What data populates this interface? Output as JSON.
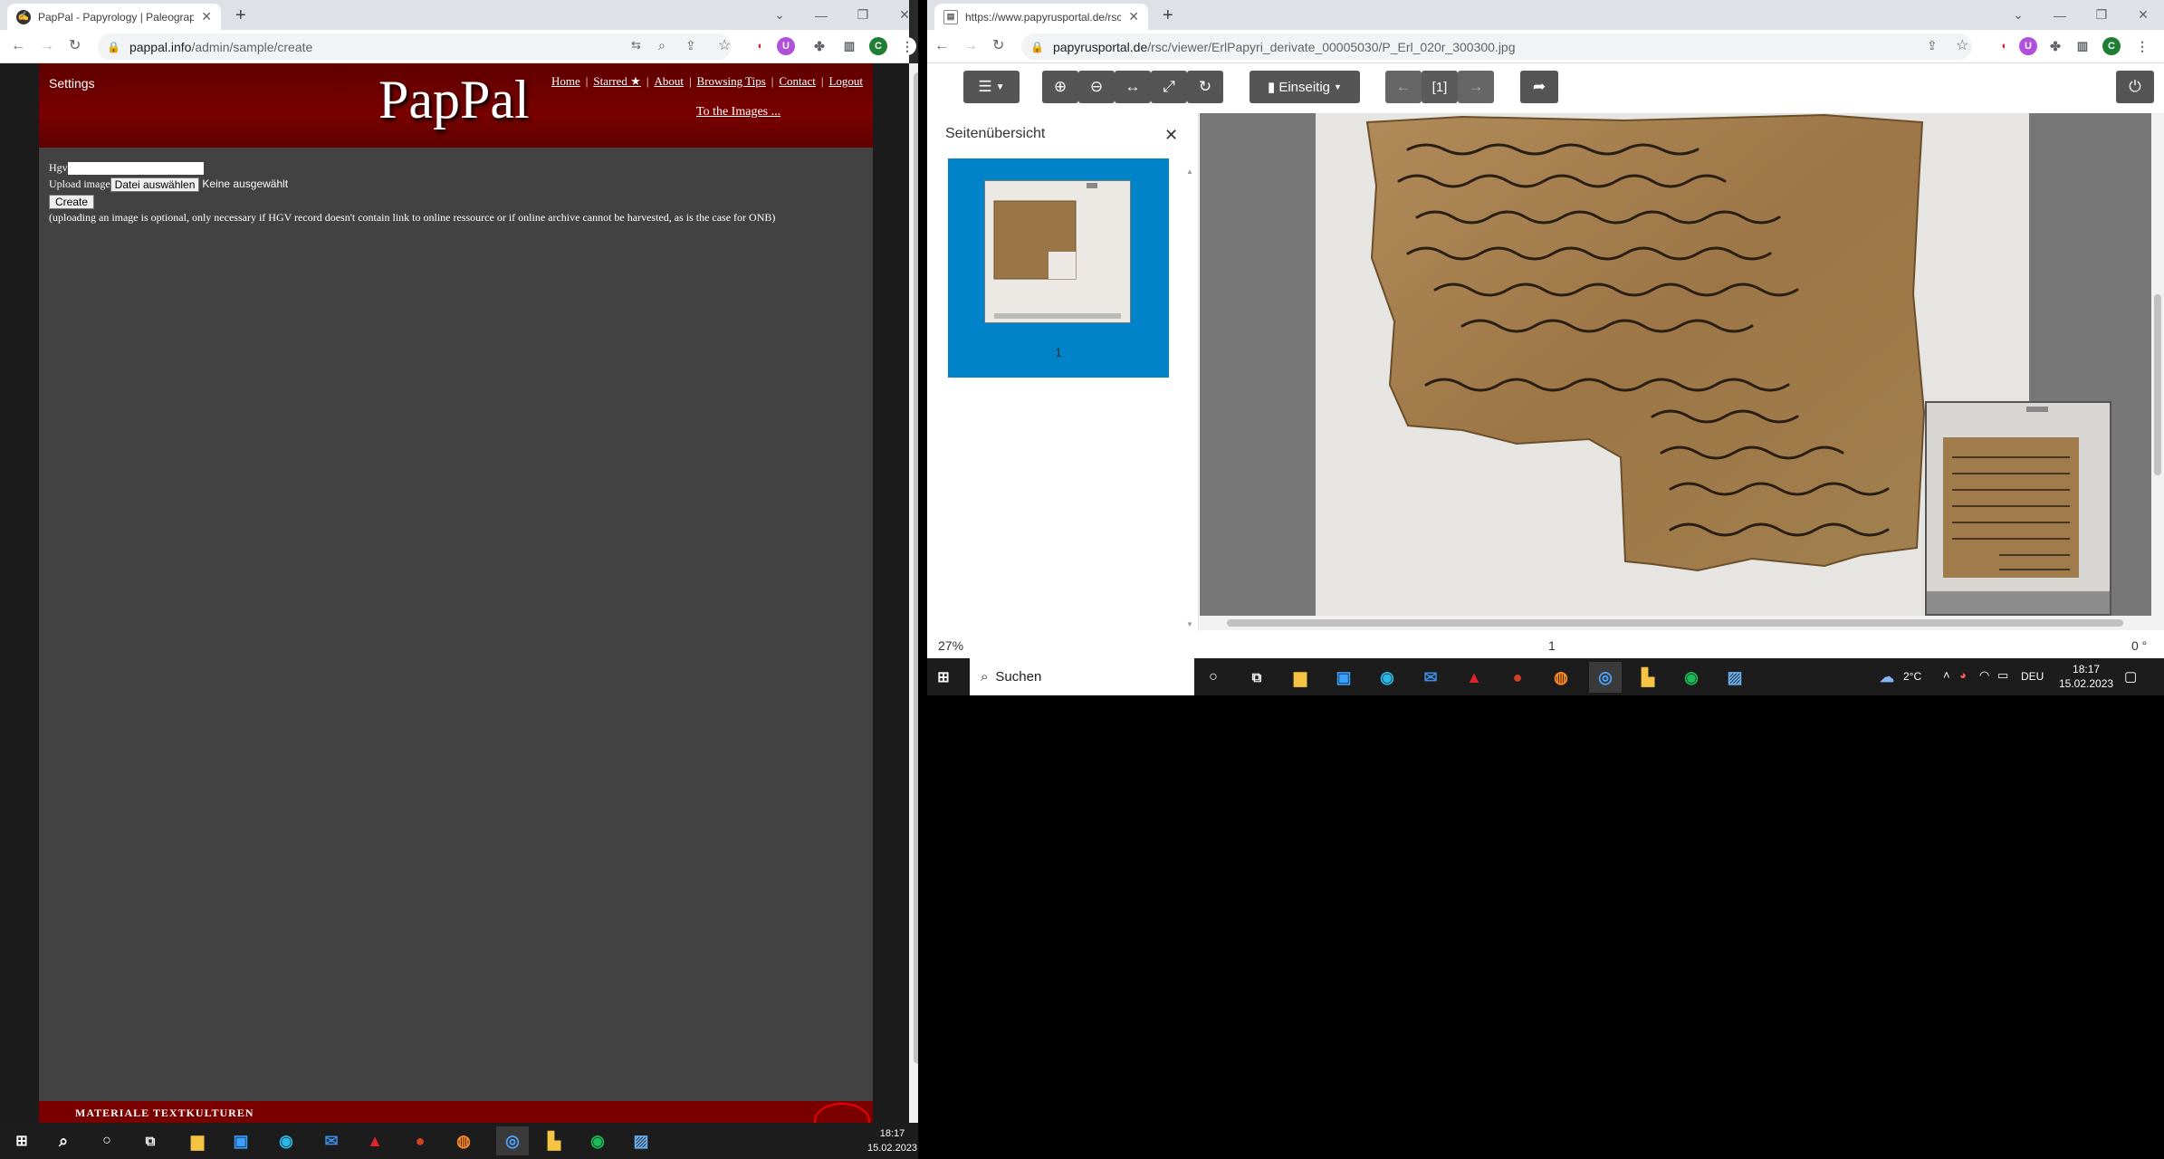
{
  "left_browser": {
    "tab_title": "PapPal - Papyrology | Paleograph",
    "url_host": "pappal.info",
    "url_path": "/admin/sample/create",
    "profile_initial": "C"
  },
  "pappal": {
    "settings_label": "Settings",
    "logo": "PapPal",
    "nav": [
      "Home",
      "Starred ★",
      "About",
      "Browsing Tips",
      "Contact",
      "Logout"
    ],
    "nav_separator": "|",
    "to_images": "To the Images ...",
    "form": {
      "hgv_label": "Hgv",
      "hgv_value": "",
      "upload_label": "Upload image",
      "choose_file_button": "Datei auswählen",
      "no_file_text": "Keine ausgewählt",
      "create_button": "Create",
      "note": "(uploading an image is optional, only necessary if HGV record doesn't contain link to online ressource or if online archive cannot be harvested, as is the case for ONB)"
    },
    "footer_text": "Materiale Textkulturen"
  },
  "right_browser": {
    "tab_title": "https://www.papyrusportal.de/rsc",
    "url_host": "papyrusportal.de",
    "url_path": "/rsc/viewer/ErlPapyri_derivate_00005030/P_Erl_020r_300300.jpg",
    "profile_initial": "C"
  },
  "viewer": {
    "layout_button": "Einseitig",
    "page_indicator": "[1]",
    "sidebar_title": "Seitenübersicht",
    "thumbnail_label": "1",
    "zoom_level": "27%",
    "page_number": "1",
    "rotation": "0 °"
  },
  "taskbar_right": {
    "search_placeholder": "Suchen",
    "weather": "2°C",
    "language": "DEU",
    "time": "18:17",
    "date": "15.02.2023"
  },
  "taskbar_left": {
    "time": "18:17",
    "date": "15.02.2023"
  },
  "colors": {
    "pappal_red": "#7a0000",
    "viewer_blue": "#0083c9",
    "papyrus": "#a6804f"
  }
}
